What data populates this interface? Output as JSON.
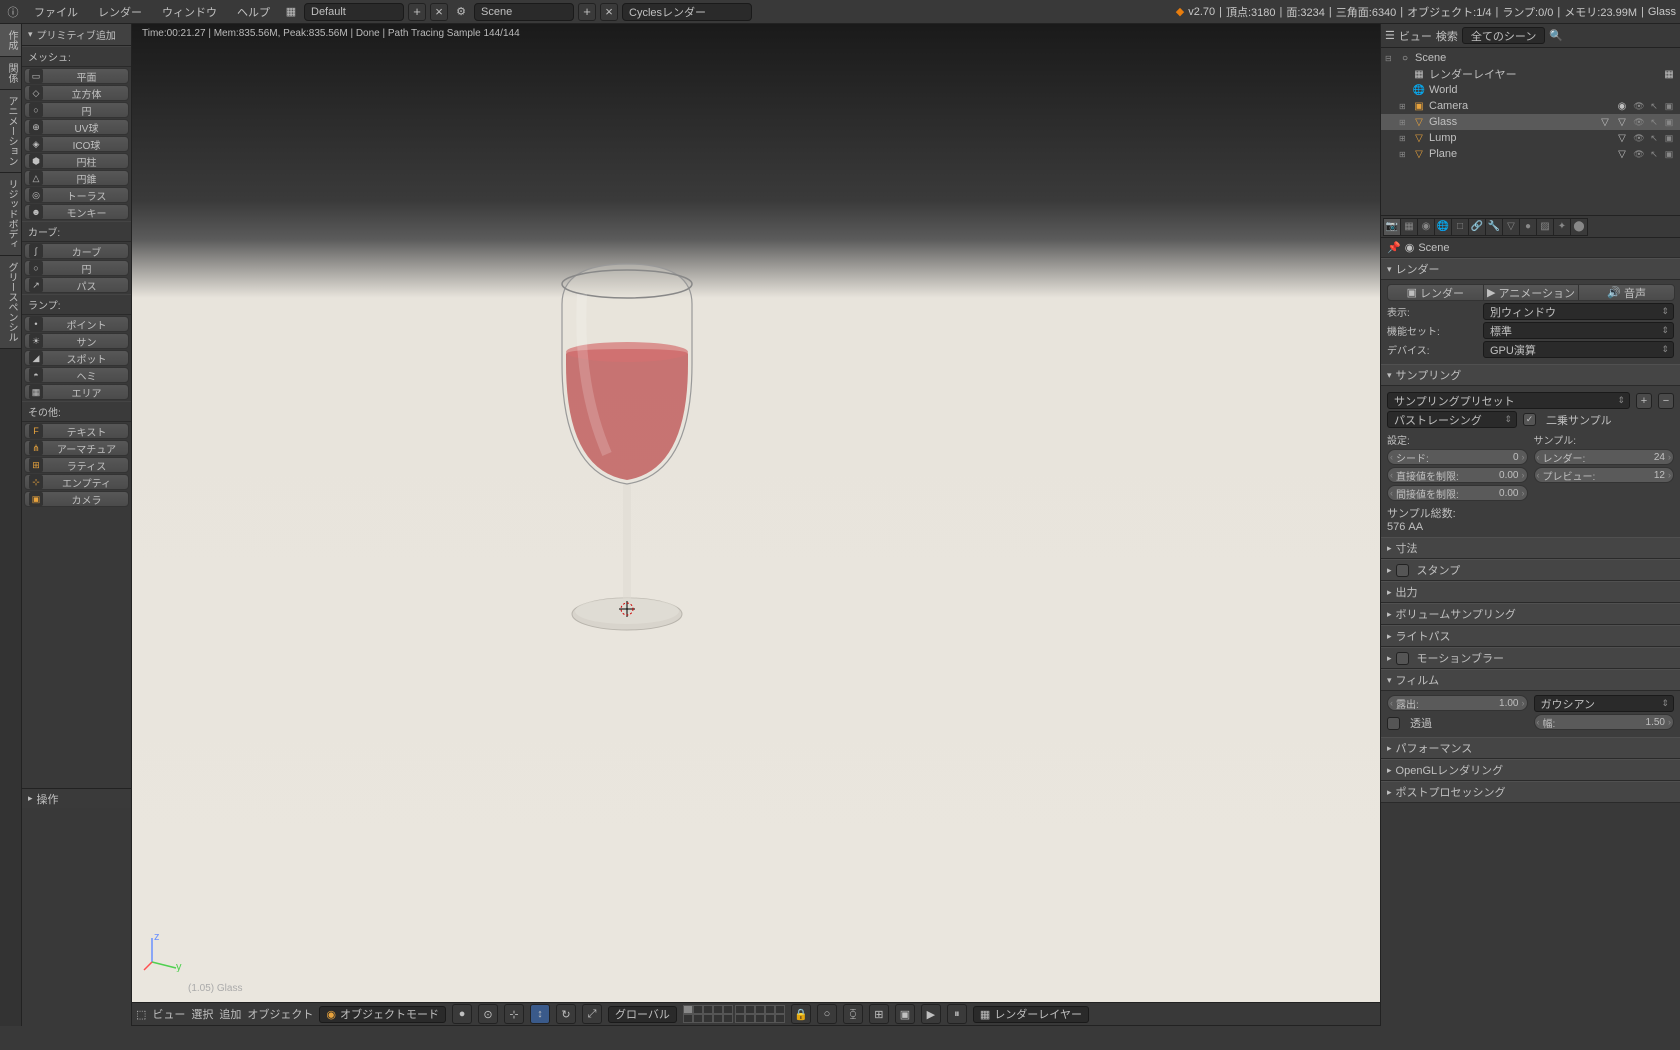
{
  "topmenu": {
    "i": "i",
    "file": "ファイル",
    "render": "レンダー",
    "window": "ウィンドウ",
    "help": "ヘルプ",
    "layout": "Default",
    "scene": "Scene",
    "engine": "Cyclesレンダー"
  },
  "stats": {
    "version": "v2.70",
    "verts": "頂点:3180",
    "faces": "面:3234",
    "tris": "三角面:6340",
    "objects": "オブジェクト:1/4",
    "lamps": "ランプ:0/0",
    "mem": "メモリ:23.99M",
    "obj": "Glass"
  },
  "renderinfo": "Time:00:21.27 | Mem:835.56M, Peak:835.56M | Done | Path Tracing Sample 144/144",
  "toolshelf": {
    "title": "プリミティブ追加",
    "cat_mesh": "メッシュ:",
    "mesh": [
      "平面",
      "立方体",
      "円",
      "UV球",
      "ICO球",
      "円柱",
      "円錐",
      "トーラス",
      "モンキー"
    ],
    "cat_curve": "カーブ:",
    "curve": [
      "カーブ",
      "円",
      "パス"
    ],
    "cat_lamp": "ランプ:",
    "lamp": [
      "ポイント",
      "サン",
      "スポット",
      "ヘミ",
      "エリア"
    ],
    "cat_other": "その他:",
    "other": [
      "テキスト",
      "アーマチュア",
      "ラティス",
      "エンプティ",
      "カメラ"
    ]
  },
  "lefttabs": [
    "作成",
    "関係",
    "アニメーション",
    "リジッドボディ",
    "グリースペンシル"
  ],
  "ops": "操作",
  "vp_objlabel": "(1.05) Glass",
  "outliner": {
    "viewlabel": "ビュー",
    "search": "検索",
    "filter": "全てのシーン",
    "scene": "Scene",
    "rl": "レンダーレイヤー",
    "world": "World",
    "camera": "Camera",
    "glass": "Glass",
    "lump": "Lump",
    "plane": "Plane"
  },
  "prop_breadcrumb": "Scene",
  "panels": {
    "render": {
      "title": "レンダー",
      "render_btn": "レンダー",
      "anim_btn": "アニメーション",
      "audio_btn": "音声",
      "display_lbl": "表示:",
      "display_val": "別ウィンドウ",
      "feature_lbl": "機能セット:",
      "feature_val": "標準",
      "device_lbl": "デバイス:",
      "device_val": "GPU演算"
    },
    "sampling": {
      "title": "サンプリング",
      "preset": "サンプリングプリセット",
      "integrator": "パストレーシング",
      "square": "二乗サンプル",
      "settings": "設定:",
      "samples": "サンプル:",
      "seed_lbl": "シード:",
      "seed_val": "0",
      "clamp_d_lbl": "直接値を制限:",
      "clamp_d_val": "0.00",
      "clamp_i_lbl": "間接値を制限:",
      "clamp_i_val": "0.00",
      "render_lbl": "レンダー:",
      "render_val": "24",
      "preview_lbl": "プレビュー:",
      "preview_val": "12",
      "total_lbl": "サンプル総数:",
      "total_val": "576 AA"
    },
    "dim": "寸法",
    "stamp": "スタンプ",
    "output": "出力",
    "vol": "ボリュームサンプリング",
    "light": "ライトパス",
    "mb": "モーションブラー",
    "film": {
      "title": "フィルム",
      "exposure_lbl": "露出:",
      "exposure_val": "1.00",
      "filter": "ガウシアン",
      "transparent": "透過",
      "width_lbl": "幅:",
      "width_val": "1.50"
    },
    "perf": "パフォーマンス",
    "ogl": "OpenGLレンダリング",
    "post": "ポストプロセッシング"
  },
  "vpheader": {
    "view": "ビュー",
    "select": "選択",
    "add": "追加",
    "object": "オブジェクト",
    "mode": "オブジェクトモード",
    "orient": "グローバル",
    "rlayer": "レンダーレイヤー"
  }
}
